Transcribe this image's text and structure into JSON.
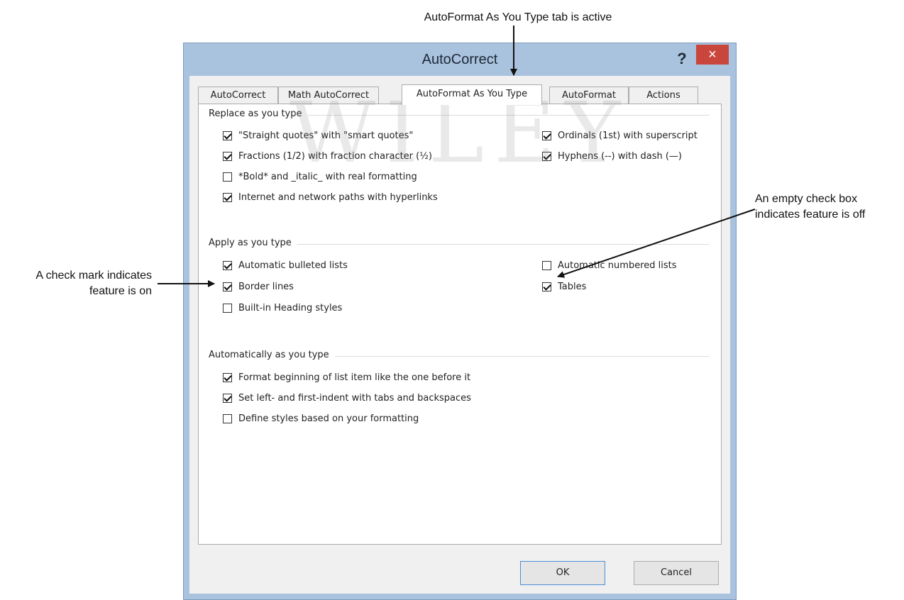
{
  "callouts": {
    "top": "AutoFormat As You Type tab is active",
    "left": "A check mark indicates feature is on",
    "right": "An empty check box indicates feature is off"
  },
  "watermark": "WILEY",
  "dialog": {
    "title": "AutoCorrect",
    "help_label": "?",
    "close_label": "×",
    "tabs": [
      {
        "label": "AutoCorrect",
        "active": false
      },
      {
        "label": "Math AutoCorrect",
        "active": false
      },
      {
        "label": "AutoFormat As You Type",
        "active": true
      },
      {
        "label": "AutoFormat",
        "active": false
      },
      {
        "label": "Actions",
        "active": false
      }
    ],
    "groups": {
      "replace": {
        "label": "Replace as you type",
        "options": [
          {
            "label": "\"Straight quotes\" with \"smart quotes\"",
            "checked": true
          },
          {
            "label": "Fractions (1/2) with fraction character (½)",
            "checked": true
          },
          {
            "label": "*Bold* and _italic_ with real formatting",
            "checked": false
          },
          {
            "label": "Internet and network paths with hyperlinks",
            "checked": true
          },
          {
            "label": "Ordinals (1st) with superscript",
            "checked": true
          },
          {
            "label": "Hyphens (--) with dash (—)",
            "checked": true
          }
        ]
      },
      "apply": {
        "label": "Apply as you type",
        "options": [
          {
            "label": "Automatic bulleted lists",
            "checked": true
          },
          {
            "label": "Border lines",
            "checked": true
          },
          {
            "label": "Built-in Heading styles",
            "checked": false
          },
          {
            "label": "Automatic numbered lists",
            "checked": false
          },
          {
            "label": "Tables",
            "checked": true
          }
        ]
      },
      "auto": {
        "label": "Automatically as you type",
        "options": [
          {
            "label": "Format beginning of list item like the one before it",
            "checked": true
          },
          {
            "label": "Set left- and first-indent with tabs and backspaces",
            "checked": true
          },
          {
            "label": "Define styles based on your formatting",
            "checked": false
          }
        ]
      }
    },
    "buttons": {
      "ok": "OK",
      "cancel": "Cancel"
    }
  }
}
